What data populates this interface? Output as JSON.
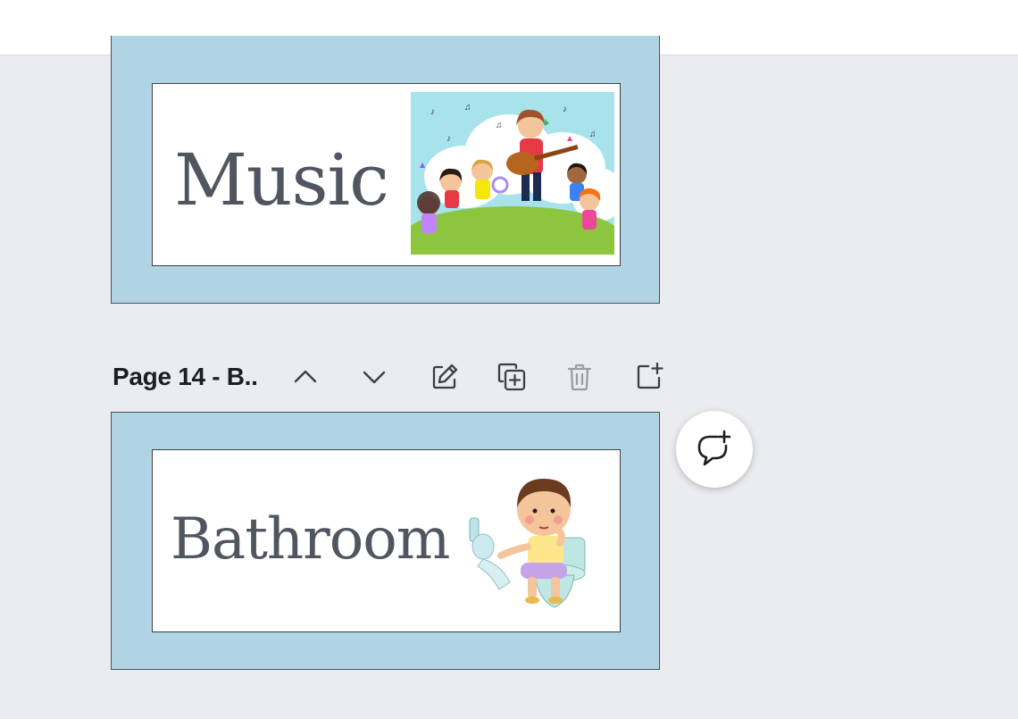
{
  "pages": {
    "music_card": {
      "word": "Music",
      "illustration": "children-music-circle-illustration"
    },
    "bathroom_card": {
      "word": "Bathroom",
      "illustration": "child-on-toilet-illustration"
    }
  },
  "page_toolbar": {
    "label": "Page 14 - B..",
    "tools": [
      "chevron-up-icon",
      "chevron-down-icon",
      "edit-title-icon",
      "duplicate-page-icon",
      "trash-icon",
      "add-page-icon"
    ]
  },
  "comment_button": {
    "icon": "add-comment-icon"
  },
  "colors": {
    "canvas_bg": "#ebecf0",
    "card_border": "#b0d4e3",
    "text": "#50565f"
  }
}
